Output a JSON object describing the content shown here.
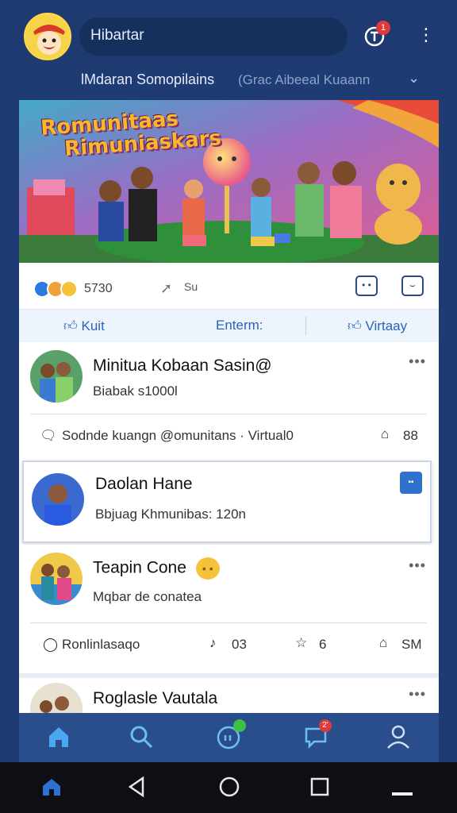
{
  "header": {
    "search_text": "Hibartar",
    "notification_count": "1",
    "subtitle_main": "lMdaran Somopilains",
    "subtitle_secondary": "(Grac Aibeeal Kuaann"
  },
  "banner": {
    "title_line1": "Romunitaas",
    "title_line2": "Rimuniaskars"
  },
  "stats": {
    "reaction_count": "5730",
    "share_count": "Su"
  },
  "actions": {
    "left": "Kuit",
    "center": "Enterm:",
    "right": "Virtaay"
  },
  "posts": [
    {
      "name": "Minitua Kobaan Sasin@",
      "meta": "Biabak s1000l",
      "footer_text": "Sodnde kuangn @omunitans · Virtual0",
      "footer_count": "88"
    },
    {
      "name": "Daolan Hane",
      "meta": "Bbjuag Khmunibas: 120n"
    },
    {
      "name": "Teapin Cone",
      "meta": "Mqbar de conatea",
      "footer_text": "Ronlinlasaqo",
      "likes": "03",
      "shares": "6",
      "saves": "SM"
    },
    {
      "name": "Roglasle Vautala"
    }
  ],
  "app_nav": {
    "badge_chat": "",
    "badge_messages": "2'"
  },
  "colors": {
    "header_bg": "#1e3a70",
    "accent_blue": "#2a63b8",
    "app_nav_bg": "#2a4e8c",
    "badge_red": "#e23a3a",
    "badge_green": "#3fbf4a"
  }
}
